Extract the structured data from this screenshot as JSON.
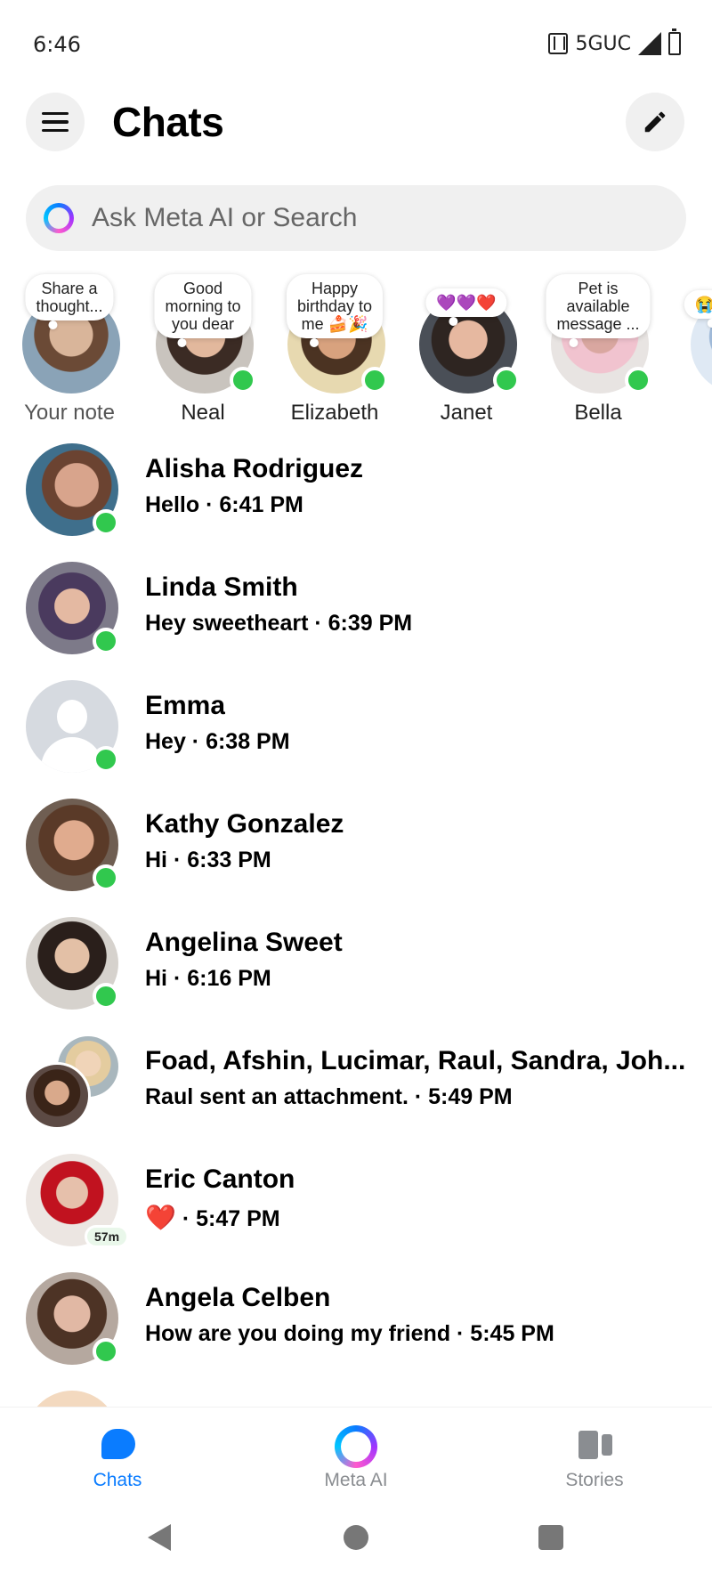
{
  "status_bar": {
    "time": "6:46",
    "network": "5GUC",
    "icons": [
      "nfc-icon",
      "signal-icon",
      "battery-icon"
    ]
  },
  "header": {
    "title": "Chats",
    "menu_icon": "hamburger-menu-icon",
    "compose_icon": "pencil-icon"
  },
  "search": {
    "placeholder": "Ask Meta AI or Search",
    "icon": "meta-ai-ring-icon"
  },
  "notes": [
    {
      "name": "Your note",
      "note": "Share a\nthought...",
      "online": false
    },
    {
      "name": "Neal",
      "note": "Good\nmorning to\nyou dear",
      "online": true
    },
    {
      "name": "Elizabeth",
      "note": "Happy\nbirthday to\nme 🍰🎉",
      "online": true
    },
    {
      "name": "Janet",
      "note": "💜💜❤️",
      "online": true
    },
    {
      "name": "Bella",
      "note": "Pet is\navailable\nmessage ...",
      "online": true
    },
    {
      "name": "",
      "note": "😭",
      "online": false
    }
  ],
  "chats": [
    {
      "name": "Alisha Rodriguez",
      "preview": "Hello · 6:41 PM",
      "online": true
    },
    {
      "name": "Linda Smith",
      "preview": "Hey sweetheart · 6:39 PM",
      "online": true
    },
    {
      "name": "Emma",
      "preview": "Hey · 6:38 PM",
      "online": true
    },
    {
      "name": "Kathy Gonzalez",
      "preview": "Hi · 6:33 PM",
      "online": true
    },
    {
      "name": "Angelina Sweet",
      "preview": "Hi · 6:16 PM",
      "online": true
    },
    {
      "name": "Foad, Afshin, Lucimar, Raul, Sandra, Joh...",
      "preview": "Raul sent an attachment. · 5:49 PM",
      "online": false
    },
    {
      "name": "Eric Canton",
      "preview_emoji": "❤️",
      "preview": " · 5:47 PM",
      "last_active": "57m",
      "online": false
    },
    {
      "name": "Angela Celben",
      "preview": "How are you doing my friend · 5:45 PM",
      "online": true
    }
  ],
  "bottom_nav": {
    "tabs": [
      {
        "label": "Chats",
        "icon": "chat-bubble-icon",
        "active": true
      },
      {
        "label": "Meta AI",
        "icon": "meta-ai-ring-icon",
        "active": false
      },
      {
        "label": "Stories",
        "icon": "stories-icon",
        "active": false
      }
    ]
  },
  "colors": {
    "accent": "#0a7cff",
    "online": "#31c84e",
    "muted": "#8a8d91"
  }
}
